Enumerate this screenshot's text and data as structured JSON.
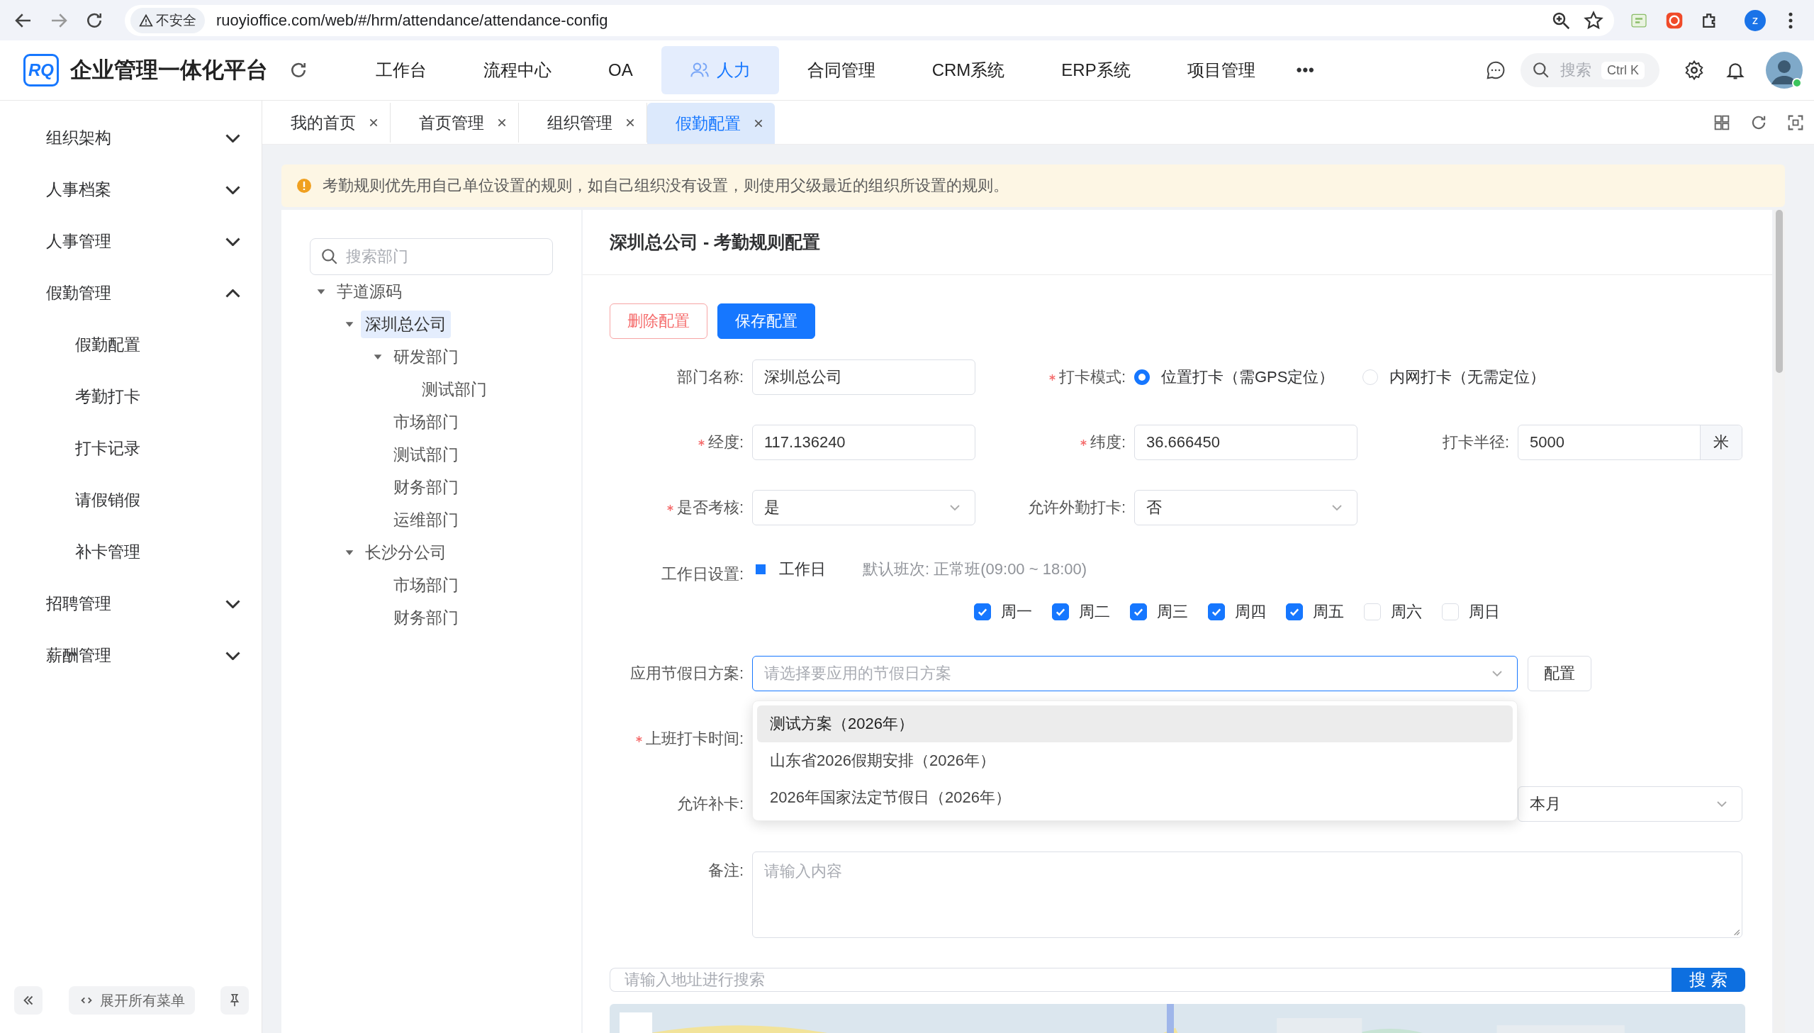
{
  "browser": {
    "security": "不安全",
    "url": "ruoyioffice.com/web/#/hrm/attendance/attendance-config",
    "profile": "z"
  },
  "header": {
    "logo": "RQ",
    "title": "企业管理一体化平台",
    "nav": [
      {
        "label": "工作台",
        "selected": false
      },
      {
        "label": "流程中心",
        "selected": false
      },
      {
        "label": "OA",
        "selected": false
      },
      {
        "label": "人力",
        "selected": true
      },
      {
        "label": "合同管理",
        "selected": false
      },
      {
        "label": "CRM系统",
        "selected": false
      },
      {
        "label": "ERP系统",
        "selected": false
      },
      {
        "label": "项目管理",
        "selected": false
      }
    ],
    "more": "•••",
    "search": {
      "placeholder": "搜索",
      "shortcut": "Ctrl K"
    }
  },
  "sidebar": {
    "items": [
      {
        "label": "组织架构",
        "expanded": false
      },
      {
        "label": "人事档案",
        "expanded": false
      },
      {
        "label": "人事管理",
        "expanded": false
      },
      {
        "label": "假勤管理",
        "expanded": true,
        "children": [
          {
            "label": "假勤配置"
          },
          {
            "label": "考勤打卡"
          },
          {
            "label": "打卡记录"
          },
          {
            "label": "请假销假"
          },
          {
            "label": "补卡管理"
          }
        ]
      },
      {
        "label": "招聘管理",
        "expanded": false
      },
      {
        "label": "薪酬管理",
        "expanded": false
      }
    ],
    "expand_all": "展开所有菜单"
  },
  "tabs": [
    {
      "label": "我的首页",
      "selected": false
    },
    {
      "label": "首页管理",
      "selected": false
    },
    {
      "label": "组织管理",
      "selected": false
    },
    {
      "label": "假勤配置",
      "selected": true
    }
  ],
  "alert": "考勤规则优先用自己单位设置的规则，如自己组织没有设置，则使用父级最近的组织所设置的规则。",
  "tree": {
    "placeholder": "搜索部门",
    "nodes": [
      {
        "label": "芋道源码",
        "expanded": true,
        "selected": false,
        "children": [
          {
            "label": "深圳总公司",
            "expanded": true,
            "selected": true,
            "children": [
              {
                "label": "研发部门",
                "expanded": true,
                "selected": false,
                "children": [
                  {
                    "label": "测试部门",
                    "selected": false
                  }
                ]
              },
              {
                "label": "市场部门",
                "selected": false
              },
              {
                "label": "测试部门",
                "selected": false
              },
              {
                "label": "财务部门",
                "selected": false
              },
              {
                "label": "运维部门",
                "selected": false
              }
            ]
          },
          {
            "label": "长沙分公司",
            "expanded": true,
            "selected": false,
            "children": [
              {
                "label": "市场部门",
                "selected": false
              },
              {
                "label": "财务部门",
                "selected": false
              }
            ]
          }
        ]
      }
    ]
  },
  "form": {
    "title": "深圳总公司 - 考勤规则配置",
    "delete_button": "删除配置",
    "save_button": "保存配置",
    "department": {
      "label": "部门名称:",
      "value": "深圳总公司"
    },
    "punch_mode": {
      "label": "打卡模式:",
      "required": true,
      "options": [
        {
          "label": "位置打卡（需GPS定位）",
          "selected": true
        },
        {
          "label": "内网打卡（无需定位）",
          "selected": false
        }
      ]
    },
    "longitude": {
      "label": "经度:",
      "required": true,
      "value": "117.136240"
    },
    "latitude": {
      "label": "纬度:",
      "required": true,
      "value": "36.666450"
    },
    "radius": {
      "label": "打卡半径:",
      "value": "5000",
      "unit": "米"
    },
    "assess": {
      "label": "是否考核:",
      "required": true,
      "value": "是"
    },
    "outside": {
      "label": "允许外勤打卡:",
      "value": "否"
    },
    "workday": {
      "label": "工作日设置:",
      "checkbox_label": "工作日",
      "indeterminate": true,
      "default_shift": "默认班次: 正常班(09:00 ~ 18:00)",
      "days": [
        {
          "label": "周一",
          "checked": true
        },
        {
          "label": "周二",
          "checked": true
        },
        {
          "label": "周三",
          "checked": true
        },
        {
          "label": "周四",
          "checked": true
        },
        {
          "label": "周五",
          "checked": true
        },
        {
          "label": "周六",
          "checked": false
        },
        {
          "label": "周日",
          "checked": false
        }
      ]
    },
    "holiday": {
      "label": "应用节假日方案:",
      "placeholder": "请选择要应用的节假日方案",
      "config_button": "配置",
      "options": [
        {
          "label": "测试方案（2026年）",
          "highlighted": true
        },
        {
          "label": "山东省2026假期安排（2026年）",
          "highlighted": false
        },
        {
          "label": "2026年国家法定节假日（2026年）",
          "highlighted": false
        }
      ]
    },
    "checkin_time": {
      "label": "上班打卡时间:",
      "required": true
    },
    "makeup": {
      "label": "允许补卡:",
      "period": "本月"
    },
    "remark": {
      "label": "备注:",
      "placeholder": "请输入内容"
    },
    "address": {
      "placeholder": "请输入地址进行搜索",
      "button": "搜 索"
    }
  }
}
